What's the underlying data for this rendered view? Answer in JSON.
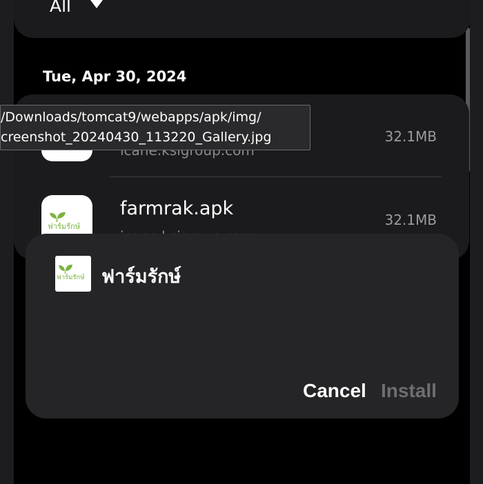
{
  "filter": {
    "label": "All"
  },
  "date_header": "Tue, Apr 30, 2024",
  "tooltip": {
    "line1": "/Downloads/tomcat9/webapps/apk/img/",
    "line2": "creenshot_20240430_113220_Gallery.jpg"
  },
  "files": [
    {
      "name": "",
      "host": "icane.ksigroup.com",
      "size": "32.1MB"
    },
    {
      "name": "farmrak.apk",
      "host": "icane.ksigroup.com",
      "size": "32.1MB"
    }
  ],
  "dialog": {
    "app_name": "ฟาร์มรักษ์",
    "logo_text": "ฟาร์มรักษ์",
    "cancel_label": "Cancel",
    "install_label": "Install"
  },
  "colors": {
    "background": "#000000",
    "card": "#1b1b1d",
    "dialog": "#252527",
    "install_disabled": "#6e6e72",
    "logo_green": "#7bb33f",
    "logo_pink": "#d4607a"
  }
}
